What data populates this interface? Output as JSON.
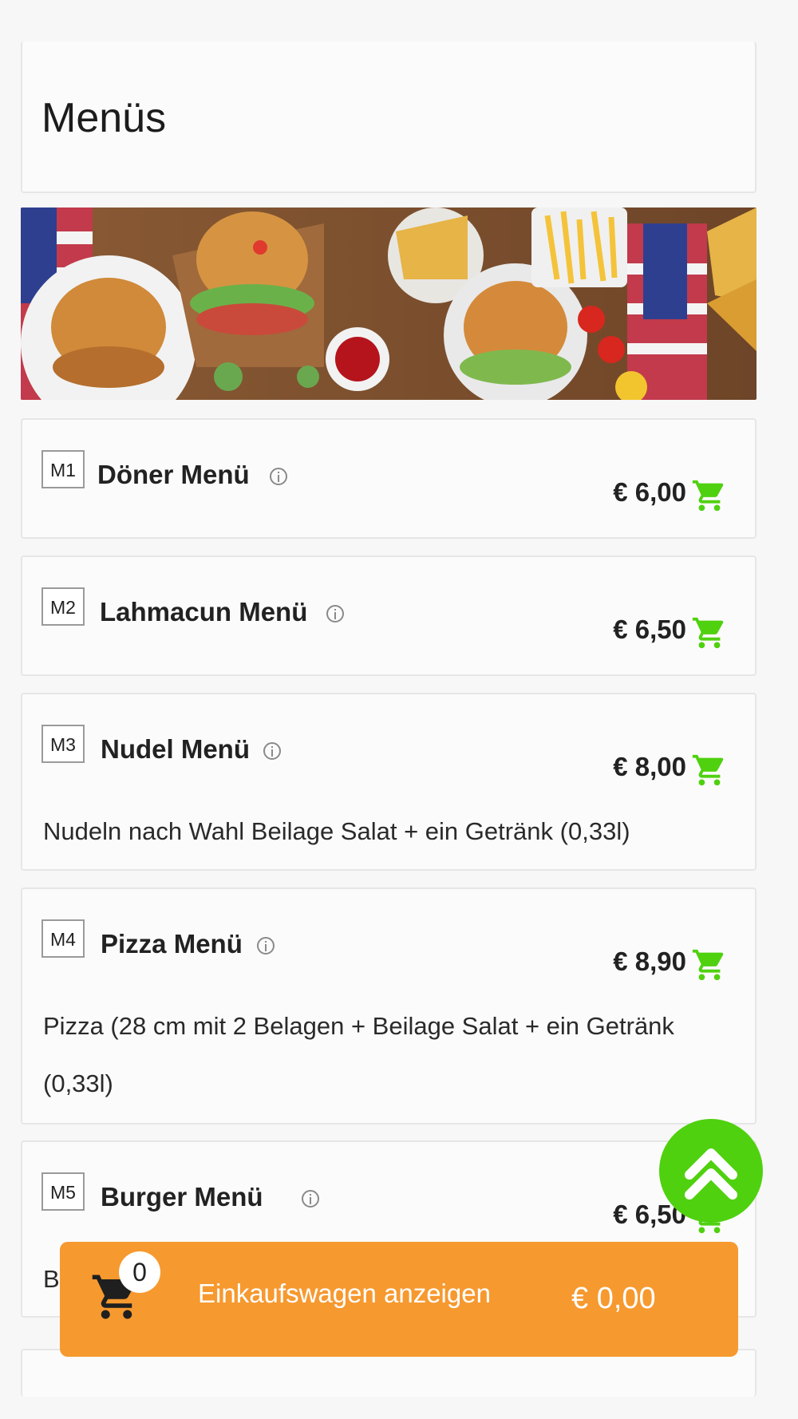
{
  "page": {
    "title": "Menüs"
  },
  "banner": {
    "alt": "fast food banner"
  },
  "items": [
    {
      "code": "M1",
      "name": "Döner Menü",
      "price": "€ 6,00",
      "desc": ""
    },
    {
      "code": "M2",
      "name": "Lahmacun Menü",
      "price": "€ 6,50",
      "desc": ""
    },
    {
      "code": "M3",
      "name": "Nudel Menü",
      "price": "€ 8,00",
      "desc": "Nudeln nach Wahl Beilage Salat + ein Getränk (0,33l)"
    },
    {
      "code": "M4",
      "name": "Pizza Menü",
      "price": "€ 8,90",
      "desc": "Pizza (28 cm mit 2 Belagen + Beilage Salat + ein Getränk (0,33l)"
    },
    {
      "code": "M5",
      "name": "Burger Menü",
      "price": "€ 6,50",
      "desc": "B"
    }
  ],
  "cart_bar": {
    "count": "0",
    "label": "Einkaufswagen anzeigen",
    "total": "€ 0,00"
  },
  "colors": {
    "accent_green": "#4fd10f",
    "cart_orange": "#f6992f"
  },
  "icons": {
    "info": "info-icon",
    "cart": "cart-icon",
    "scroll_top": "chevrons-up-icon"
  }
}
